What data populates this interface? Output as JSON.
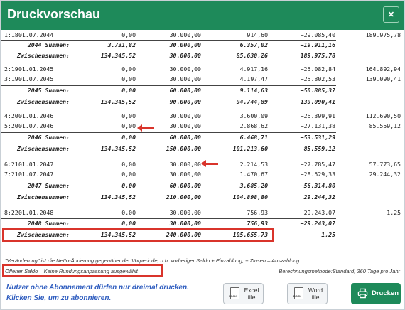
{
  "header": {
    "title": "Druckvorschau",
    "close_symbol": "✕"
  },
  "rows": [
    {
      "type": "data",
      "no": "1:18",
      "date": "01.07.2044",
      "c1": "0,00",
      "c2": "30.000,00",
      "c3": "914,60",
      "c4": "−29.085,40",
      "c5": "189.975,78"
    },
    {
      "type": "sum",
      "label": "2044 Summen:",
      "c1": "3.731,82",
      "c2": "30.000,00",
      "c3": "6.357,02",
      "c4": "−19.911,16",
      "c5": ""
    },
    {
      "type": "sum",
      "label": "Zwischensummen:",
      "c1": "134.345,52",
      "c2": "30.000,00",
      "c3": "85.630,26",
      "c4": "189.975,78",
      "c5": ""
    },
    {
      "type": "data",
      "no": "2:19",
      "date": "01.01.2045",
      "c1": "0,00",
      "c2": "30.000,00",
      "c3": "4.917,16",
      "c4": "−25.082,84",
      "c5": "164.892,94"
    },
    {
      "type": "data",
      "no": "3:19",
      "date": "01.07.2045",
      "c1": "0,00",
      "c2": "30.000,00",
      "c3": "4.197,47",
      "c4": "−25.802,53",
      "c5": "139.090,41"
    },
    {
      "type": "sum",
      "label": "2045 Summen:",
      "c1": "0,00",
      "c2": "60.000,00",
      "c3": "9.114,63",
      "c4": "−50.885,37",
      "c5": ""
    },
    {
      "type": "sum",
      "label": "Zwischensummen:",
      "c1": "134.345,52",
      "c2": "90.000,00",
      "c3": "94.744,89",
      "c4": "139.090,41",
      "c5": ""
    },
    {
      "type": "data",
      "no": "4:20",
      "date": "01.01.2046",
      "c1": "0,00",
      "c2": "30.000,00",
      "c3": "3.600,09",
      "c4": "−26.399,91",
      "c5": "112.690,50"
    },
    {
      "type": "data",
      "no": "5:20",
      "date": "01.07.2046",
      "c1": "0,00",
      "c2": "30.000,00",
      "c3": "2.868,62",
      "c4": "−27.131,38",
      "c5": "85.559,12"
    },
    {
      "type": "sum",
      "label": "2046 Summen:",
      "c1": "0,00",
      "c2": "60.000,00",
      "c3": "6.468,71",
      "c4": "−53.531,29",
      "c5": ""
    },
    {
      "type": "sum",
      "label": "Zwischensummen:",
      "c1": "134.345,52",
      "c2": "150.000,00",
      "c3": "101.213,60",
      "c4": "85.559,12",
      "c5": ""
    },
    {
      "type": "data",
      "no": "6:21",
      "date": "01.01.2047",
      "c1": "0,00",
      "c2": "30.000,00",
      "c3": "2.214,53",
      "c4": "−27.785,47",
      "c5": "57.773,65"
    },
    {
      "type": "data",
      "no": "7:21",
      "date": "01.07.2047",
      "c1": "0,00",
      "c2": "30.000,00",
      "c3": "1.470,67",
      "c4": "−28.529,33",
      "c5": "29.244,32"
    },
    {
      "type": "sum",
      "label": "2047 Summen:",
      "c1": "0,00",
      "c2": "60.000,00",
      "c3": "3.685,20",
      "c4": "−56.314,80",
      "c5": ""
    },
    {
      "type": "sum",
      "label": "Zwischensummen:",
      "c1": "134.345,52",
      "c2": "210.000,00",
      "c3": "104.898,80",
      "c4": "29.244,32",
      "c5": ""
    },
    {
      "type": "data",
      "no": "8:22",
      "date": "01.01.2048",
      "c1": "0,00",
      "c2": "30.000,00",
      "c3": "756,93",
      "c4": "−29.243,07",
      "c5": "1,25"
    },
    {
      "type": "sum",
      "label": "2048 Summen:",
      "c1": "0,00",
      "c2": "30.000,00",
      "c3": "756,93",
      "c4": "−29.243,07",
      "c5": ""
    },
    {
      "type": "sum",
      "label": "Zwischensummen:",
      "c1": "134.345,52",
      "c2": "240.000,00",
      "c3": "105.655,73",
      "c4": "1,25",
      "c5": ""
    }
  ],
  "notes": {
    "explanation": "\"Veränderung\" ist die Netto-Änderung gegenüber der Vorperiode, d.h. vorheriger Saldo + Einzahlung, + Zinsen – Auszahlung.",
    "offener_saldo": "Offener Saldo – Keine Rundungsanpassung ausgewählt",
    "berechnungsmethode": "Berechnungsmethode:Standard, 360 Tage pro Jahr"
  },
  "footer": {
    "notice_line1": "Nutzer ohne Abonnement dürfen nur dreimal drucken.",
    "notice_line2": "Klicken Sie, um zu abonnieren.",
    "excel_label": "Excel file",
    "excel_badge": "XLSX",
    "word_label": "Word file",
    "word_badge": "DOCX",
    "print_label": "Drucken"
  },
  "colors": {
    "brand": "#1e8a5a",
    "highlight": "#d9342b",
    "link": "#2f5dbf"
  }
}
